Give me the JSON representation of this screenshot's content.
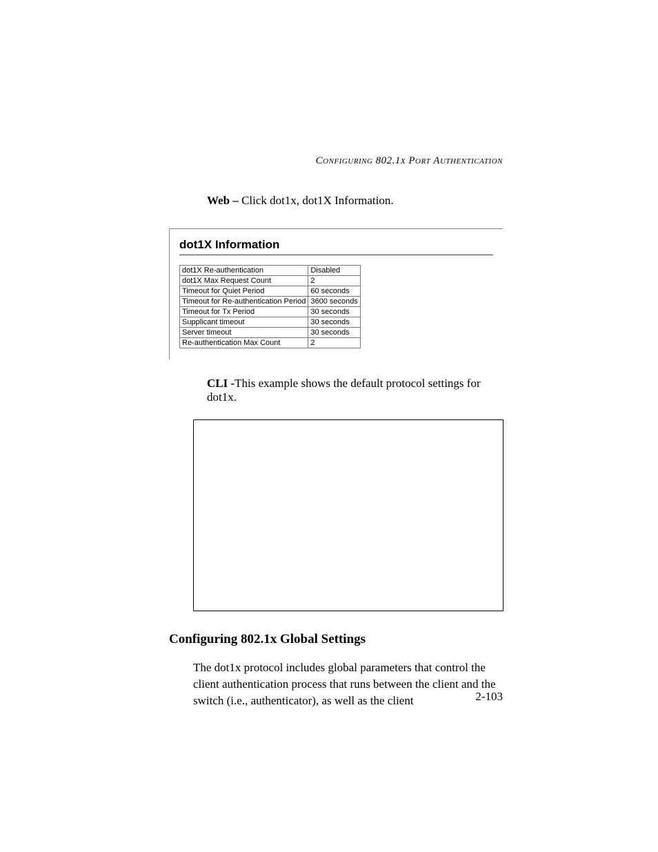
{
  "running_head": "Configuring 802.1x Port Authentication",
  "web_line": {
    "lead": "Web –",
    "rest": " Click dot1x, dot1X Information."
  },
  "panel": {
    "title": "dot1X Information",
    "rows": [
      {
        "label": "dot1X Re-authentication",
        "value": "Disabled"
      },
      {
        "label": "dot1X Max Request Count",
        "value": "2"
      },
      {
        "label": "Timeout for Quiet Period",
        "value": "60 seconds"
      },
      {
        "label": "Timeout for Re-authentication Period",
        "value": "3600 seconds"
      },
      {
        "label": "Timeout for Tx Period",
        "value": "30 seconds"
      },
      {
        "label": "Supplicant timeout",
        "value": "30 seconds"
      },
      {
        "label": "Server timeout",
        "value": "30 seconds"
      },
      {
        "label": "Re-authentication Max Count",
        "value": "2"
      }
    ]
  },
  "cli_line": {
    "lead": "CLI -",
    "rest": "This example shows the default protocol settings for dot1x."
  },
  "section": {
    "heading": "Configuring 802.1x Global Settings",
    "body": "The dot1x protocol includes global parameters that control the client authentication process that runs between the client and the switch (i.e., authenticator), as well as the client"
  },
  "page_number": "2-103"
}
